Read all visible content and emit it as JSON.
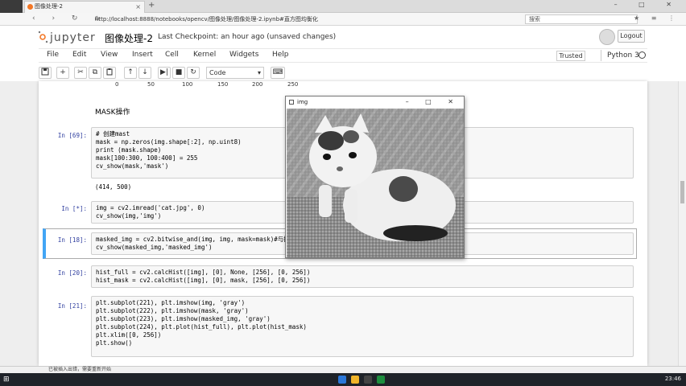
{
  "browser": {
    "tab_title": "图像处理-2",
    "new_tab": "+",
    "url": "http://localhost:8888/notebooks/opencv/图像处理/图像处理-2.ipynb#直方图均衡化",
    "search_placeholder": "搜索",
    "window_buttons": "– □ ✕",
    "nav_buttons": "‹ › ↻ ⌂",
    "right_icons": "★ ≡ ⋮"
  },
  "jupyter": {
    "logo": "jupyter",
    "title": "图像处理-2",
    "checkpoint": "Last Checkpoint: an hour ago (unsaved changes)",
    "logout": "Logout",
    "menu": [
      "File",
      "Edit",
      "View",
      "Insert",
      "Cell",
      "Kernel",
      "Widgets",
      "Help"
    ],
    "trusted": "Trusted",
    "kernel": "Python 3",
    "toolbar": {
      "save": "💾",
      "add": "+",
      "cut": "✂",
      "copy": "⧉",
      "paste": "📋",
      "up": "↑",
      "down": "↓",
      "run": "▶|",
      "stop": "■",
      "restart": "↻",
      "cell_type": "Code",
      "keyboard": "⌨"
    }
  },
  "notebook": {
    "axis_ticks": [
      "0",
      "50",
      "100",
      "150",
      "200",
      "250"
    ],
    "markdown": "MASK操作",
    "cells": [
      {
        "prompt": "In [69]:",
        "code": "# 创建mast\nmask = np.zeros(img.shape[:2], np.uint8)\nprint (mask.shape)\nmask[100:300, 100:400] = 255\ncv_show(mask,'mask')",
        "output": "(414, 500)"
      },
      {
        "prompt": "In [*]:",
        "code": "img = cv2.imread('cat.jpg', 0)\ncv_show(img,'img')",
        "output": ""
      },
      {
        "prompt": "In [18]:",
        "code": "masked_img = cv2.bitwise_and(img, img, mask=mask)#与操作\ncv_show(masked_img,'masked_img')",
        "output": ""
      },
      {
        "prompt": "In [20]:",
        "code": "hist_full = cv2.calcHist([img], [0], None, [256], [0, 256])\nhist_mask = cv2.calcHist([img], [0], mask, [256], [0, 256])",
        "output": ""
      },
      {
        "prompt": "In [21]:",
        "code": "plt.subplot(221), plt.imshow(img, 'gray')\nplt.subplot(222), plt.imshow(mask, 'gray')\nplt.subplot(223), plt.imshow(masked_img, 'gray')\nplt.subplot(224), plt.plot(hist_full), plt.plot(hist_mask)\nplt.xlim([0, 256])\nplt.show()",
        "output": ""
      }
    ]
  },
  "image_window": {
    "title": "img",
    "controls": "– □ ✕"
  },
  "taskbar": {
    "status": "已被插入出错，需要重新开始",
    "start": "⊞",
    "time": "23:46"
  }
}
